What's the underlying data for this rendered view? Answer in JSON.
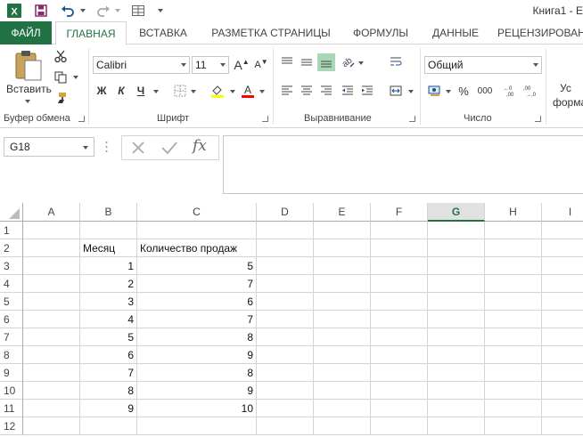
{
  "title": "Книга1 - E",
  "tabs": [
    "ФАЙЛ",
    "ГЛАВНАЯ",
    "ВСТАВКА",
    "РАЗМЕТКА СТРАНИЦЫ",
    "ФОРМУЛЫ",
    "ДАННЫЕ",
    "РЕЦЕНЗИРОВАН"
  ],
  "ribbon": {
    "paste_label": "Вставить",
    "font_name": "Calibri",
    "font_size": "11",
    "bold": "Ж",
    "italic": "К",
    "underline": "Ч",
    "number_format": "Общий",
    "percent": "%",
    "thousands": "000",
    "cond_format_line1": "Ус",
    "cond_format_line2": "форма",
    "groups": {
      "clipboard": "Буфер обмена",
      "font": "Шрифт",
      "alignment": "Выравнивание",
      "number": "Число"
    },
    "accent": "#217346",
    "highlight_color": "#ffff00",
    "font_color": "#ff0000"
  },
  "formula_bar": {
    "name_box": "G18",
    "fx": "fx",
    "formula": ""
  },
  "grid": {
    "columns": [
      "A",
      "B",
      "C",
      "D",
      "E",
      "F",
      "G",
      "H",
      "I"
    ],
    "selected_column": "G",
    "rows": [
      "1",
      "2",
      "3",
      "4",
      "5",
      "6",
      "7",
      "8",
      "9",
      "10",
      "11",
      "12"
    ],
    "cells": {
      "B2": "Месяц",
      "C2": "Количество продаж",
      "B3": "1",
      "C3": "5",
      "B4": "2",
      "C4": "7",
      "B5": "3",
      "C5": "6",
      "B6": "4",
      "C6": "7",
      "B7": "5",
      "C7": "8",
      "B8": "6",
      "C8": "9",
      "B9": "7",
      "C9": "8",
      "B10": "8",
      "C10": "9",
      "B11": "9",
      "C11": "10"
    }
  }
}
